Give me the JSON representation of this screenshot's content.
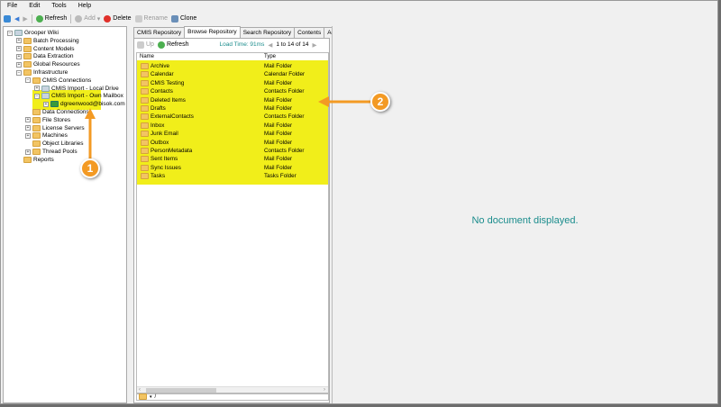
{
  "menu": [
    "File",
    "Edit",
    "Tools",
    "Help"
  ],
  "toolbar": {
    "refresh": "Refresh",
    "add": "Add",
    "delete": "Delete",
    "rename": "Rename",
    "clone": "Clone"
  },
  "tree": [
    {
      "label": "Grooper Wiki",
      "level": 0,
      "exp": "−"
    },
    {
      "label": "Batch Processing",
      "level": 1,
      "exp": "+"
    },
    {
      "label": "Content Models",
      "level": 1,
      "exp": "+"
    },
    {
      "label": "Data Extraction",
      "level": 1,
      "exp": "+"
    },
    {
      "label": "Global Resources",
      "level": 1,
      "exp": "+"
    },
    {
      "label": "Infrastructure",
      "level": 1,
      "exp": "−"
    },
    {
      "label": "CMIS Connections",
      "level": 2,
      "exp": "−"
    },
    {
      "label": "CMIS Import - Local Drive",
      "level": 3,
      "exp": "+"
    },
    {
      "label": "CMIS Import - Own Mailbox",
      "level": 3,
      "exp": "−"
    },
    {
      "label": "dgreenwood@bisok.com",
      "level": 4,
      "exp": "+"
    },
    {
      "label": "Data Connections",
      "level": 2,
      "exp": ""
    },
    {
      "label": "File Stores",
      "level": 2,
      "exp": "+"
    },
    {
      "label": "License Servers",
      "level": 2,
      "exp": "+"
    },
    {
      "label": "Machines",
      "level": 2,
      "exp": "+"
    },
    {
      "label": "Object Libraries",
      "level": 2,
      "exp": ""
    },
    {
      "label": "Thread Pools",
      "level": 2,
      "exp": "+"
    },
    {
      "label": "Reports",
      "level": 1,
      "exp": ""
    }
  ],
  "tabs": [
    "CMIS Repository",
    "Browse Repository",
    "Search Repository",
    "Contents",
    "Advanced"
  ],
  "active_tab": 1,
  "browse": {
    "up": "Up",
    "refresh": "Refresh",
    "load_time": "Load Time: 91ms",
    "paging": "1 to 14 of 14",
    "path": "/"
  },
  "columns": {
    "name": "Name",
    "type": "Type"
  },
  "rows": [
    {
      "name": "Archive",
      "type": "Mail Folder"
    },
    {
      "name": "Calendar",
      "type": "Calendar Folder"
    },
    {
      "name": "CMIS Testing",
      "type": "Mail Folder"
    },
    {
      "name": "Contacts",
      "type": "Contacts Folder"
    },
    {
      "name": "Deleted Items",
      "type": "Mail Folder"
    },
    {
      "name": "Drafts",
      "type": "Mail Folder"
    },
    {
      "name": "ExternalContacts",
      "type": "Contacts Folder"
    },
    {
      "name": "Inbox",
      "type": "Mail Folder"
    },
    {
      "name": "Junk Email",
      "type": "Mail Folder"
    },
    {
      "name": "Outbox",
      "type": "Mail Folder"
    },
    {
      "name": "PersonMetadata",
      "type": "Contacts Folder"
    },
    {
      "name": "Sent Items",
      "type": "Mail Folder"
    },
    {
      "name": "Sync Issues",
      "type": "Mail Folder"
    },
    {
      "name": "Tasks",
      "type": "Tasks Folder"
    }
  ],
  "viewer": {
    "message": "No document displayed."
  },
  "callouts": [
    "1",
    "2"
  ],
  "colors": {
    "highlight": "#f1ee1a",
    "callout": "#f39a24",
    "accent": "#1a8c8c"
  }
}
